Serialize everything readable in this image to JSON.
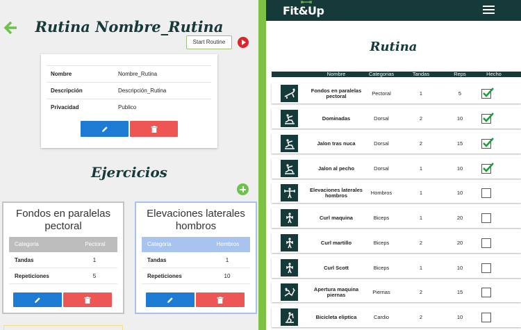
{
  "left": {
    "title": "Rutina Nombre_Rutina",
    "start_label": "Start Routine",
    "info": [
      {
        "key": "Nombre",
        "value": "Nombre_Rutina"
      },
      {
        "key": "Descripción",
        "value": "Descripción_Rutina"
      },
      {
        "key": "Privacidad",
        "value": "Publico"
      }
    ],
    "section_title": "Ejercicios",
    "cards": [
      {
        "name": "Fondos en paralelas pectoral",
        "head_left": "Categoria",
        "head_right": "Pectoral",
        "rows": [
          {
            "label": "Tandas",
            "value": "1"
          },
          {
            "label": "Repeticiones",
            "value": "5"
          }
        ]
      },
      {
        "name": "Elevaciones laterales hombros",
        "head_left": "Categoria",
        "head_right": "Hombros",
        "rows": [
          {
            "label": "Tandas",
            "value": "1"
          },
          {
            "label": "Repeticiones",
            "value": "10"
          }
        ]
      }
    ]
  },
  "right": {
    "logo": "Fit&Up",
    "title": "Rutina",
    "headers": {
      "nombre": "Nombre",
      "categorias": "Categorias",
      "tandas": "Tandas",
      "reps": "Reps",
      "hecho": "Hecho"
    },
    "rows": [
      {
        "name": "Fondos en paralelas pectoral",
        "category": "Pectoral",
        "tandas": "1",
        "reps": "5",
        "done": true,
        "icon": "pushup-icon"
      },
      {
        "name": "Dominadas",
        "category": "Dorsal",
        "tandas": "2",
        "reps": "10",
        "done": true,
        "icon": "rowing-icon"
      },
      {
        "name": "Jalon tras nuca",
        "category": "Dorsal",
        "tandas": "2",
        "reps": "15",
        "done": true,
        "icon": "rowing-icon"
      },
      {
        "name": "Jalon al pecho",
        "category": "Dorsal",
        "tandas": "1",
        "reps": "10",
        "done": true,
        "icon": "rowing-icon"
      },
      {
        "name": "Elevaciones laterales hombros",
        "category": "Hombros",
        "tandas": "1",
        "reps": "10",
        "done": false,
        "icon": "lateral-raise-icon"
      },
      {
        "name": "Curl maquina",
        "category": "Biceps",
        "tandas": "1",
        "reps": "20",
        "done": false,
        "icon": "curl-icon"
      },
      {
        "name": "Curl martillo",
        "category": "Biceps",
        "tandas": "2",
        "reps": "20",
        "done": false,
        "icon": "curl-icon"
      },
      {
        "name": "Curl Scott",
        "category": "Biceps",
        "tandas": "1",
        "reps": "10",
        "done": false,
        "icon": "curl-icon"
      },
      {
        "name": "Apertura maquina piernas",
        "category": "Piernas",
        "tandas": "2",
        "reps": "15",
        "done": false,
        "icon": "leg-press-icon"
      },
      {
        "name": "Bicicleta eliptica",
        "category": "Cardio",
        "tandas": "2",
        "reps": "10",
        "done": false,
        "icon": "elliptical-icon"
      }
    ]
  },
  "colors": {
    "dark": "#163a3a",
    "green": "#7dc242",
    "blue": "#1e7bd3",
    "red": "#ee5555"
  }
}
